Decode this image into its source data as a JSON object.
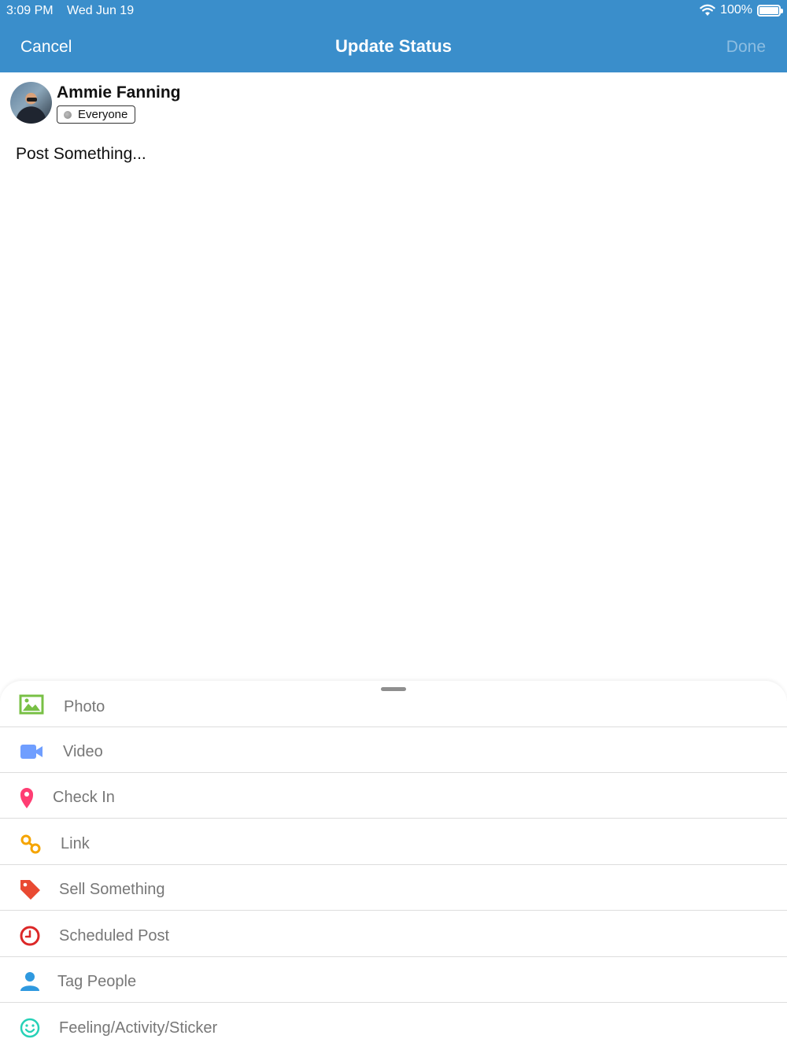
{
  "status_bar": {
    "time": "3:09 PM",
    "date": "Wed Jun 19",
    "battery": "100%",
    "battery_level": 1.0,
    "icons": [
      "wifi-icon",
      "battery-icon"
    ]
  },
  "nav": {
    "cancel": "Cancel",
    "title": "Update Status",
    "done": "Done",
    "bar_color": "#3a8ecb"
  },
  "user": {
    "name": "Ammie Fanning",
    "audience": "Everyone",
    "audience_icon": "globe-icon"
  },
  "composer": {
    "placeholder": "Post Something..."
  },
  "options": [
    {
      "label": "Photo",
      "icon": "photo-icon",
      "color": "#78c045"
    },
    {
      "label": "Video",
      "icon": "video-camera-icon",
      "color": "#6f9eff"
    },
    {
      "label": "Check In",
      "icon": "location-pin-icon",
      "color": "#ff3d73"
    },
    {
      "label": "Link",
      "icon": "link-icon",
      "color": "#f5a400"
    },
    {
      "label": "Sell Something",
      "icon": "price-tag-icon",
      "color": "#e94a32"
    },
    {
      "label": "Scheduled Post",
      "icon": "clock-icon",
      "color": "#dc2828"
    },
    {
      "label": "Tag People",
      "icon": "person-icon",
      "color": "#2f99df"
    },
    {
      "label": "Feeling/Activity/Sticker",
      "icon": "smiley-icon",
      "color": "#26d1b7"
    }
  ]
}
